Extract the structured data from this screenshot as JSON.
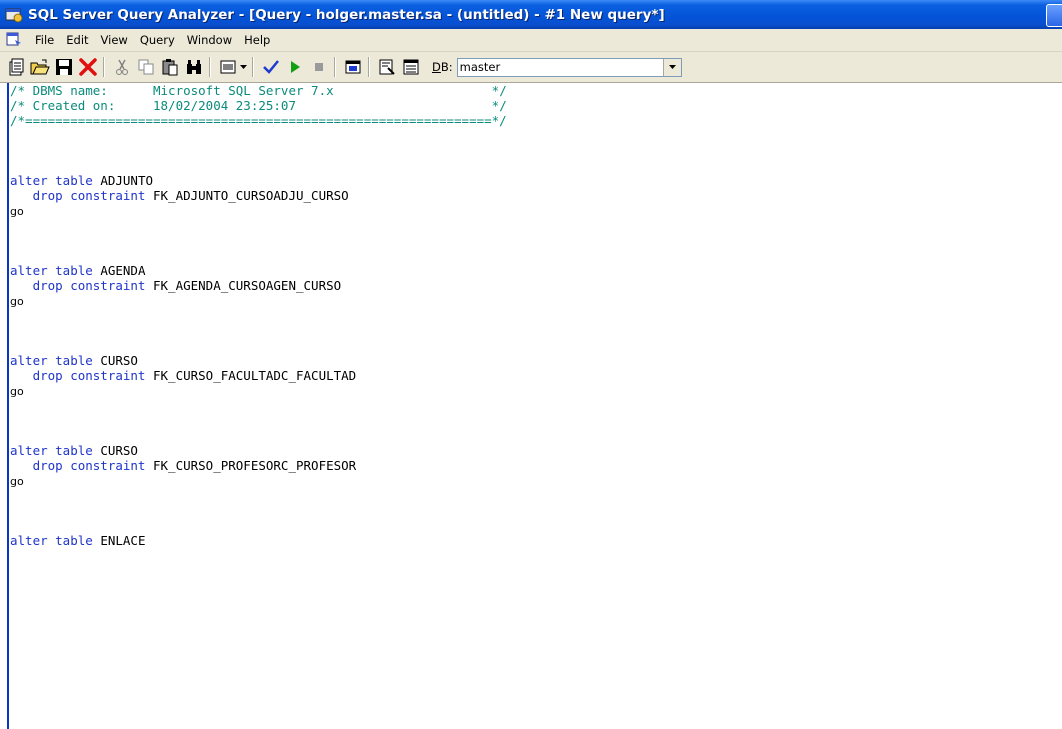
{
  "window": {
    "title": "SQL Server Query Analyzer - [Query - holger.master.sa - (untitled) - #1 New query*]"
  },
  "menu": {
    "items": [
      "File",
      "Edit",
      "View",
      "Query",
      "Window",
      "Help"
    ]
  },
  "toolbar": {
    "db_label_prefix": "D",
    "db_label_rest": "B:",
    "db_value": "master",
    "icons": [
      "new-query-icon",
      "open-icon",
      "save-icon",
      "delete-icon",
      "cut-icon",
      "copy-icon",
      "paste-icon",
      "find-icon",
      "results-mode-icon",
      "parse-icon",
      "execute-icon",
      "stop-icon",
      "object-browser-icon",
      "object-search-icon",
      "current-connection-properties-icon"
    ]
  },
  "editor": {
    "header": [
      {
        "prefix": "/* DBMS name:",
        "value": "Microsoft SQL Server 7.x",
        "suffix": "*/"
      },
      {
        "prefix": "/* Created on:",
        "value": "18/02/2004 23:25:07",
        "suffix": "*/"
      }
    ],
    "separator": "/*==============================================================*/",
    "statements": [
      {
        "table": "ADJUNTO",
        "constraint": "FK_ADJUNTO_CURSOADJU_CURSO"
      },
      {
        "table": "AGENDA",
        "constraint": "FK_AGENDA_CURSOAGEN_CURSO"
      },
      {
        "table": "CURSO",
        "constraint": "FK_CURSO_FACULTADC_FACULTAD"
      },
      {
        "table": "CURSO",
        "constraint": "FK_CURSO_PROFESORC_PROFESOR"
      },
      {
        "table": "ENLACE",
        "constraint": ""
      }
    ],
    "keywords": {
      "alter_table": "alter table",
      "drop_constraint": "drop constraint",
      "go": "go"
    }
  },
  "colors": {
    "comment": "#0b8b7b",
    "keyword": "#1f34c9",
    "titlebar": "#0453d8",
    "chrome": "#ece9d8"
  }
}
